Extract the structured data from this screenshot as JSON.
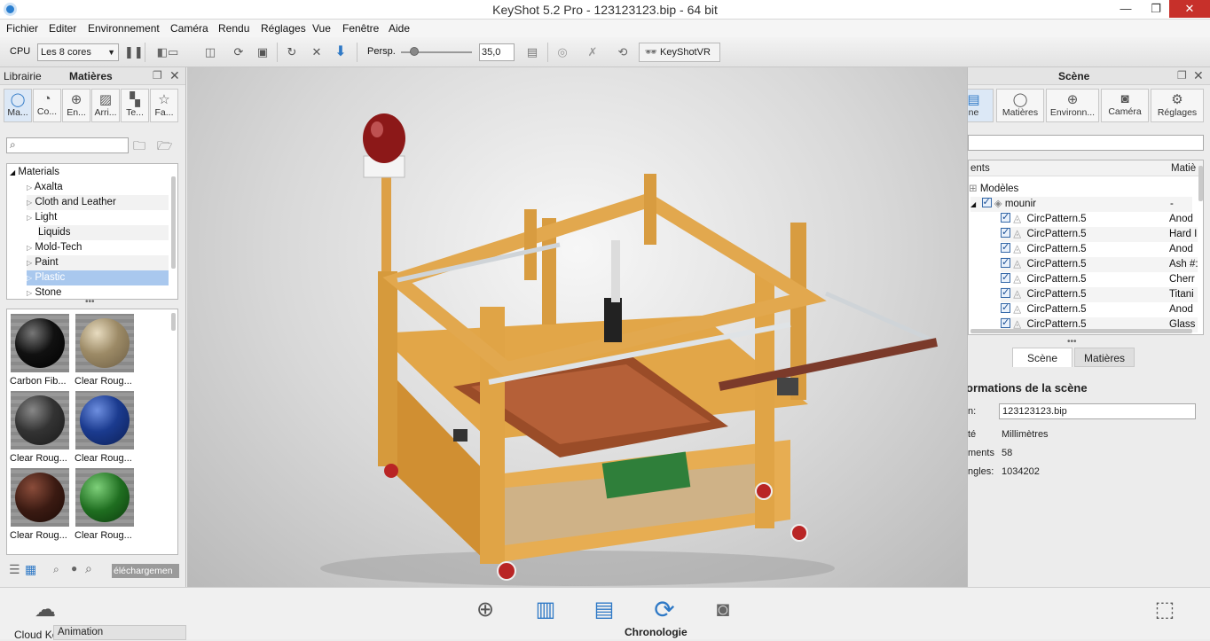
{
  "window": {
    "title": "KeyShot 5.2 Pro  -  123123123.bip  - 64 bit",
    "minimize": "—",
    "maximize": "❐",
    "close": "✕"
  },
  "menu": [
    "Fichier",
    "Editer",
    "Environnement",
    "Caméra",
    "Rendu",
    "Réglages",
    "Vue",
    "Fenêtre",
    "Aide"
  ],
  "toolbar": {
    "cpu_label": "CPU",
    "cpu_value": "Les 8 cores",
    "persp_label": "Persp.",
    "persp_value": "35,0",
    "keyshotvr_label": "KeyShotVR"
  },
  "left_panel": {
    "tab_librairie": "Librairie",
    "tab_matieres": "Matières",
    "category_tabs": [
      "Ma...",
      "Co...",
      "En...",
      "Arri...",
      "Te...",
      "Fa..."
    ],
    "search_placeholder": "",
    "tree_root": "Materials",
    "tree_items": [
      "Axalta",
      "Cloth and Leather",
      "Light",
      "Liquids",
      "Mold-Tech",
      "Paint",
      "Plastic",
      "Stone"
    ],
    "selected_item": "Plastic",
    "swatches": [
      {
        "label": "Carbon Fib...",
        "color": "#1a1a1a"
      },
      {
        "label": "Clear Roug...",
        "color": "#8a7a5a"
      },
      {
        "label": "Clear Roug...",
        "color": "#2a2a2a"
      },
      {
        "label": "Clear Roug...",
        "color": "#1b3b8f"
      },
      {
        "label": "Clear Roug...",
        "color": "#3a1a12"
      },
      {
        "label": "Clear Roug...",
        "color": "#1f6e20"
      }
    ],
    "download_label": "éléchargemen"
  },
  "right_panel": {
    "title": "Scène",
    "tabs": [
      "ne",
      "Matières",
      "Environn...",
      "Caméra",
      "Réglages"
    ],
    "col_elements": "ents",
    "col_material": "Matiè",
    "tree_models": "Modèles",
    "tree_model_name": "mounir",
    "tree_model_material": "-",
    "rows": [
      {
        "name": "CircPattern.5",
        "material": "Anod"
      },
      {
        "name": "CircPattern.5",
        "material": "Hard I"
      },
      {
        "name": "CircPattern.5",
        "material": "Anod"
      },
      {
        "name": "CircPattern.5",
        "material": "Ash #:"
      },
      {
        "name": "CircPattern.5",
        "material": "Cherr"
      },
      {
        "name": "CircPattern.5",
        "material": "Titani"
      },
      {
        "name": "CircPattern.5",
        "material": "Anod"
      },
      {
        "name": "CircPattern.5",
        "material": "Glass"
      }
    ],
    "subtabs": [
      "Scène",
      "Matières"
    ],
    "info_title": "ormations de la scène",
    "info": [
      {
        "label": "n:",
        "value": "123123123.bip"
      },
      {
        "label": "té",
        "value": "Millimètres"
      },
      {
        "label": "ments",
        "value": "58"
      },
      {
        "label": "ngles:",
        "value": "1034202"
      }
    ]
  },
  "bottom_bar": {
    "cloud_label": "Cloud Ke",
    "animation_label": "Animation",
    "chronologie_label": "Chronologie"
  },
  "colors": {
    "accent": "#2f79c6",
    "selection": "#a9c8ee",
    "wood": "#e3a541",
    "close_red": "#c7302a"
  }
}
